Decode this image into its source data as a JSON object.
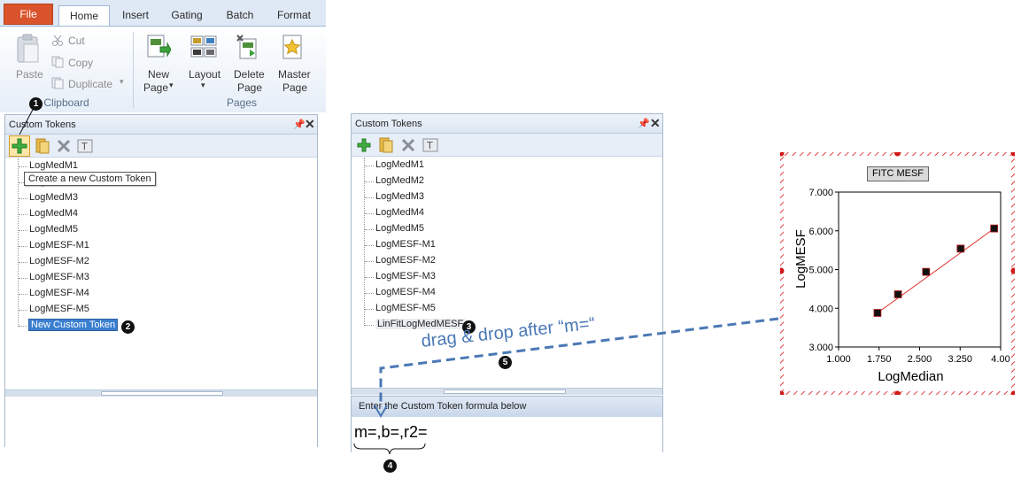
{
  "ribbon": {
    "tabs": [
      "File",
      "Home",
      "Insert",
      "Gating",
      "Batch",
      "Format"
    ],
    "active_tab": "Home",
    "clipboard": {
      "paste": "Paste",
      "cut": "Cut",
      "copy": "Copy",
      "duplicate": "Duplicate",
      "group_label": "Clipboard"
    },
    "pages": {
      "new_page_line1": "New",
      "new_page_line2": "Page",
      "layout": "Layout",
      "delete_page_line1": "Delete",
      "delete_page_line2": "Page",
      "master_page_line1": "Master",
      "master_page_line2": "Page",
      "group_label": "Pages"
    }
  },
  "left_panel": {
    "title": "Custom Tokens",
    "tooltip": "Create a new Custom Token",
    "items": [
      "LogMedM1",
      "LogMedM2",
      "LogMedM3",
      "LogMedM4",
      "LogMedM5",
      "LogMESF-M1",
      "LogMESF-M2",
      "LogMESF-M3",
      "LogMESF-M4",
      "LogMESF-M5"
    ],
    "new_item": "New Custom Token"
  },
  "right_panel": {
    "title": "Custom Tokens",
    "items": [
      "LogMedM1",
      "LogMedM2",
      "LogMedM3",
      "LogMedM4",
      "LogMedM5",
      "LogMESF-M1",
      "LogMESF-M2",
      "LogMESF-M3",
      "LogMESF-M4",
      "LogMESF-M5",
      "LinFitLogMedMESF"
    ],
    "formula_header": "Enter the Custom Token formula below",
    "formula": "m=,b=,r2="
  },
  "callouts": [
    "1",
    "2",
    "3",
    "4",
    "5"
  ],
  "annotation": {
    "drag_text": "drag & drop after “m=“",
    "color": "#4a78b5"
  },
  "colors": {
    "file_tab": "#d9532c",
    "selection": "#3b7fd0",
    "fit_line": "#e03030",
    "marker": "#111111"
  },
  "chart_data": {
    "type": "scatter",
    "title": "FITC MESF",
    "xlabel": "LogMedian",
    "ylabel": "LogMESF",
    "xlim": [
      1.0,
      4.0
    ],
    "ylim": [
      3.0,
      7.0
    ],
    "x_ticks": [
      "1.000",
      "1.750",
      "2.500",
      "3.250",
      "4.00"
    ],
    "x_tick_values": [
      1.0,
      1.75,
      2.5,
      3.25,
      4.0
    ],
    "y_ticks": [
      "3.000",
      "4.000",
      "5.000",
      "6.000",
      "7.000"
    ],
    "y_tick_values": [
      3.0,
      4.0,
      5.0,
      6.0,
      7.0
    ],
    "series": [
      {
        "x": [
          1.72,
          2.1,
          2.62,
          3.26,
          3.88
        ],
        "y": [
          3.88,
          4.36,
          4.94,
          5.54,
          6.06
        ]
      }
    ],
    "fit_line": {
      "x": [
        1.72,
        3.88
      ],
      "y": [
        3.88,
        6.06
      ]
    },
    "grid": false
  }
}
